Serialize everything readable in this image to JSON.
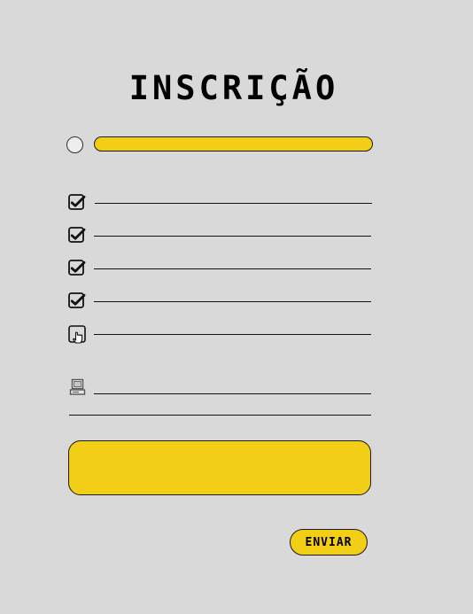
{
  "form": {
    "title": "INSCRIÇÃO",
    "submit_label": "ENVIAR"
  },
  "colors": {
    "background": "#d9d9d9",
    "accent": "#f2cf16",
    "stroke": "#111111"
  },
  "fields": [
    {
      "icon": "radio-circle",
      "type": "radio",
      "checked": false
    },
    {
      "icon": "checkbox-checked",
      "type": "checkbox",
      "checked": true
    },
    {
      "icon": "checkbox-checked",
      "type": "checkbox",
      "checked": true
    },
    {
      "icon": "checkbox-checked",
      "type": "checkbox",
      "checked": true
    },
    {
      "icon": "checkbox-checked",
      "type": "checkbox",
      "checked": true
    },
    {
      "icon": "checkbox-pointer-hand",
      "type": "checkbox",
      "checked": false
    },
    {
      "icon": "computer-icon",
      "type": "text"
    }
  ]
}
